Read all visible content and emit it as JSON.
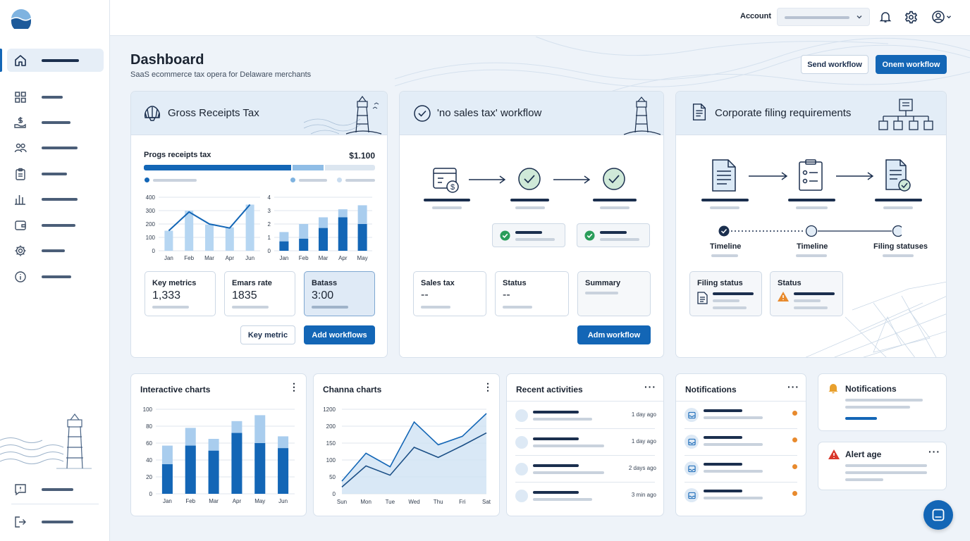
{
  "header": {
    "account_label": "Account",
    "icons": [
      "bell-icon",
      "gear-icon",
      "user-circle-icon"
    ]
  },
  "sidebar": {
    "items": [
      {
        "icon": "home-icon",
        "active": true
      },
      {
        "icon": "grid-icon"
      },
      {
        "icon": "dollar-hand-icon"
      },
      {
        "icon": "users-icon"
      },
      {
        "icon": "clipboard-icon"
      },
      {
        "icon": "bar-chart-icon"
      },
      {
        "icon": "wallet-icon"
      },
      {
        "icon": "gear-icon"
      },
      {
        "icon": "info-icon"
      },
      {
        "icon": "feedback-icon"
      },
      {
        "icon": "logout-icon"
      }
    ]
  },
  "page": {
    "title": "Dashboard",
    "subtitle": "SaaS ecommerce tax opera for Delaware merchants",
    "send_workflow": "Send workflow",
    "onem_workflow": "Onem workflow"
  },
  "gross": {
    "title": "Gross Receipts Tax",
    "progress_label": "Progs receipts tax",
    "progress_value": "$1.100",
    "progress_fill": 0.64,
    "progress_fill_2": 0.14,
    "chart1": {
      "type": "bar",
      "categories": [
        "Jan",
        "Feb",
        "Mar",
        "Apr",
        "Jun"
      ],
      "yticks": [
        "400",
        "300",
        "200",
        "100",
        "0"
      ],
      "ylim": [
        0,
        400
      ],
      "bars": [
        150,
        300,
        195,
        175,
        345
      ],
      "line": [
        150,
        290,
        200,
        170,
        345
      ]
    },
    "chart2": {
      "type": "bar",
      "categories": [
        "Jan",
        "Feb",
        "Mar",
        "Apr",
        "May"
      ],
      "yticks": [
        "4",
        "3",
        "2",
        "1",
        "0"
      ],
      "ylim": [
        0,
        4
      ],
      "total": [
        1.4,
        2.0,
        2.5,
        3.1,
        3.4
      ],
      "dark": [
        0.7,
        0.9,
        1.7,
        2.5,
        2.0
      ]
    },
    "metrics": [
      {
        "label": "Key metrics",
        "value": "1,333"
      },
      {
        "label": "Emars rate",
        "value": "1835"
      },
      {
        "label": "Batass",
        "value": "3:00"
      }
    ],
    "key_metric_btn": "Key metric",
    "add_workflows_btn": "Add workflows"
  },
  "nosales": {
    "title": "'no sales tax' workflow",
    "boxes": [
      {
        "label": "Sales tax",
        "value": "--"
      },
      {
        "label": "Status",
        "value": "--"
      },
      {
        "label": "Summary",
        "value": ""
      }
    ],
    "action_btn": "Adm workflow"
  },
  "corporate": {
    "title": "Corporate filing requirements",
    "timeline": [
      "Timeline",
      "Timeline",
      "Filing statuses"
    ],
    "boxes": [
      {
        "label": "Filing status"
      },
      {
        "label": "Status"
      }
    ]
  },
  "interactive": {
    "title": "Interactive charts",
    "chart_data": {
      "type": "bar",
      "categories": [
        "Jan",
        "Feb",
        "Mar",
        "Apr",
        "May",
        "Jun"
      ],
      "yticks": [
        "100",
        "80",
        "60",
        "40",
        "20",
        "0"
      ],
      "ylim": [
        0,
        100
      ],
      "total": [
        57,
        78,
        65,
        86,
        93,
        68
      ],
      "dark": [
        35,
        57,
        51,
        72,
        60,
        54
      ]
    }
  },
  "channa": {
    "title": "Channa charts",
    "chart_data": {
      "type": "line",
      "categories": [
        "Sun",
        "Mon",
        "Tue",
        "Wed",
        "Thu",
        "Fri",
        "Sat"
      ],
      "yticks": [
        "1200",
        "200",
        "150",
        "100",
        "50",
        "0"
      ],
      "series": [
        {
          "values": [
            0.15,
            0.48,
            0.32,
            0.85,
            0.58,
            0.68,
            0.95
          ]
        },
        {
          "values": [
            0.08,
            0.33,
            0.22,
            0.55,
            0.43,
            0.57,
            0.72
          ]
        }
      ]
    }
  },
  "recent": {
    "title": "Recent activities",
    "rows": [
      {
        "time": "1 day ago"
      },
      {
        "time": "1 day ago"
      },
      {
        "time": "2 days ago"
      },
      {
        "time": "3 min ago"
      }
    ]
  },
  "notifications": {
    "title": "Notifications",
    "rows": 4
  },
  "notify_card": {
    "title": "Notifications"
  },
  "alert_card": {
    "title": "Alert age"
  },
  "colors": {
    "primary": "#1366b6",
    "light_blue": "#a9cdee",
    "navy": "#1b2f4e",
    "success": "#2a9d5a",
    "warning": "#e88a2d"
  }
}
